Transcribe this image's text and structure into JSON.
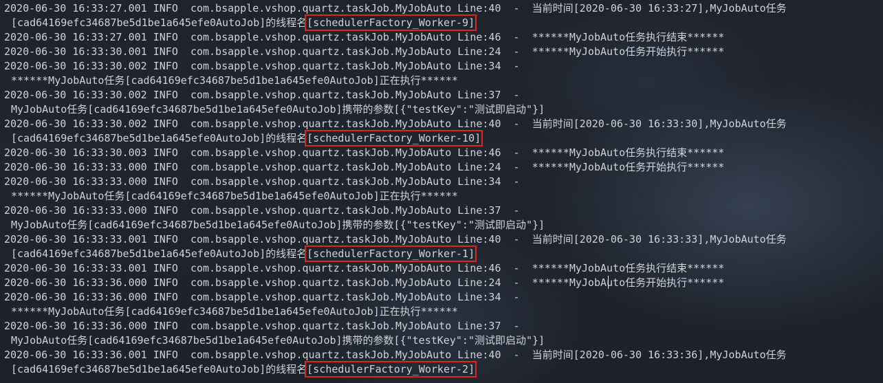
{
  "terminal": {
    "lines": [
      {
        "ts": "2020-06-30 16:33:27.001",
        "level": "INFO",
        "logger": "com.bsapple.vshop.quartz.taskJob.MyJobAuto",
        "line": "Line:40",
        "msg": "当前时间[2020-06-30 16:33:27],MyJobAuto任务"
      },
      {
        "cont": "[cad64169efc34687be5d1be1a645efe0AutoJob]的线程名",
        "highlight": "[schedulerFactory_Worker-9]"
      },
      {
        "ts": "2020-06-30 16:33:27.001",
        "level": "INFO",
        "logger": "com.bsapple.vshop.quartz.taskJob.MyJobAuto",
        "line": "Line:46",
        "msg": "******MyJobAuto任务执行结束******"
      },
      {
        "ts": "2020-06-30 16:33:30.001",
        "level": "INFO",
        "logger": "com.bsapple.vshop.quartz.taskJob.MyJobAuto",
        "line": "Line:24",
        "msg": "******MyJobAuto任务开始执行******"
      },
      {
        "ts": "2020-06-30 16:33:30.002",
        "level": "INFO",
        "logger": "com.bsapple.vshop.quartz.taskJob.MyJobAuto",
        "line": "Line:34",
        "msg": ""
      },
      {
        "cont": "******MyJobAuto任务[cad64169efc34687be5d1be1a645efe0AutoJob]正在执行******"
      },
      {
        "ts": "2020-06-30 16:33:30.002",
        "level": "INFO",
        "logger": "com.bsapple.vshop.quartz.taskJob.MyJobAuto",
        "line": "Line:37",
        "msg": ""
      },
      {
        "cont": "MyJobAuto任务[cad64169efc34687be5d1be1a645efe0AutoJob]携带的参数[{\"testKey\":\"测试即启动\"}]"
      },
      {
        "ts": "2020-06-30 16:33:30.002",
        "level": "INFO",
        "logger": "com.bsapple.vshop.quartz.taskJob.MyJobAuto",
        "line": "Line:40",
        "msg": "当前时间[2020-06-30 16:33:30],MyJobAuto任务"
      },
      {
        "cont": "[cad64169efc34687be5d1be1a645efe0AutoJob]的线程名",
        "highlight": "[schedulerFactory_Worker-10]"
      },
      {
        "ts": "2020-06-30 16:33:30.003",
        "level": "INFO",
        "logger": "com.bsapple.vshop.quartz.taskJob.MyJobAuto",
        "line": "Line:46",
        "msg": "******MyJobAuto任务执行结束******"
      },
      {
        "ts": "2020-06-30 16:33:33.000",
        "level": "INFO",
        "logger": "com.bsapple.vshop.quartz.taskJob.MyJobAuto",
        "line": "Line:24",
        "msg": "******MyJobAuto任务开始执行******"
      },
      {
        "ts": "2020-06-30 16:33:33.000",
        "level": "INFO",
        "logger": "com.bsapple.vshop.quartz.taskJob.MyJobAuto",
        "line": "Line:34",
        "msg": ""
      },
      {
        "cont": "******MyJobAuto任务[cad64169efc34687be5d1be1a645efe0AutoJob]正在执行******"
      },
      {
        "ts": "2020-06-30 16:33:33.000",
        "level": "INFO",
        "logger": "com.bsapple.vshop.quartz.taskJob.MyJobAuto",
        "line": "Line:37",
        "msg": ""
      },
      {
        "cont": "MyJobAuto任务[cad64169efc34687be5d1be1a645efe0AutoJob]携带的参数[{\"testKey\":\"测试即启动\"}]"
      },
      {
        "ts": "2020-06-30 16:33:33.001",
        "level": "INFO",
        "logger": "com.bsapple.vshop.quartz.taskJob.MyJobAuto",
        "line": "Line:40",
        "msg": "当前时间[2020-06-30 16:33:33],MyJobAuto任务"
      },
      {
        "cont": "[cad64169efc34687be5d1be1a645efe0AutoJob]的线程名",
        "highlight": "[schedulerFactory_Worker-1]"
      },
      {
        "ts": "2020-06-30 16:33:33.001",
        "level": "INFO",
        "logger": "com.bsapple.vshop.quartz.taskJob.MyJobAuto",
        "line": "Line:46",
        "msg": "******MyJobAuto任务执行结束******"
      },
      {
        "ts": "2020-06-30 16:33:36.000",
        "level": "INFO",
        "logger": "com.bsapple.vshop.quartz.taskJob.MyJobAuto",
        "line": "Line:24",
        "msg": "******MyJobAuto任务开始执行******"
      },
      {
        "ts": "2020-06-30 16:33:36.000",
        "level": "INFO",
        "logger": "com.bsapple.vshop.quartz.taskJob.MyJobAuto",
        "line": "Line:34",
        "msg": ""
      },
      {
        "cont": "******MyJobAuto任务[cad64169efc34687be5d1be1a645efe0AutoJob]正在执行******"
      },
      {
        "ts": "2020-06-30 16:33:36.000",
        "level": "INFO",
        "logger": "com.bsapple.vshop.quartz.taskJob.MyJobAuto",
        "line": "Line:37",
        "msg": ""
      },
      {
        "cont": "MyJobAuto任务[cad64169efc34687be5d1be1a645efe0AutoJob]携带的参数[{\"testKey\":\"测试即启动\"}]"
      },
      {
        "ts": "2020-06-30 16:33:36.001",
        "level": "INFO",
        "logger": "com.bsapple.vshop.quartz.taskJob.MyJobAuto",
        "line": "Line:40",
        "msg": "当前时间[2020-06-30 16:33:36],MyJobAuto任务"
      },
      {
        "cont": "[cad64169efc34687be5d1be1a645efe0AutoJob]的线程名",
        "highlight": "[schedulerFactory_Worker-2]"
      }
    ]
  },
  "colors": {
    "text": "#cfd3d9",
    "highlight_box": "#e02424",
    "background": "#1e222b"
  }
}
